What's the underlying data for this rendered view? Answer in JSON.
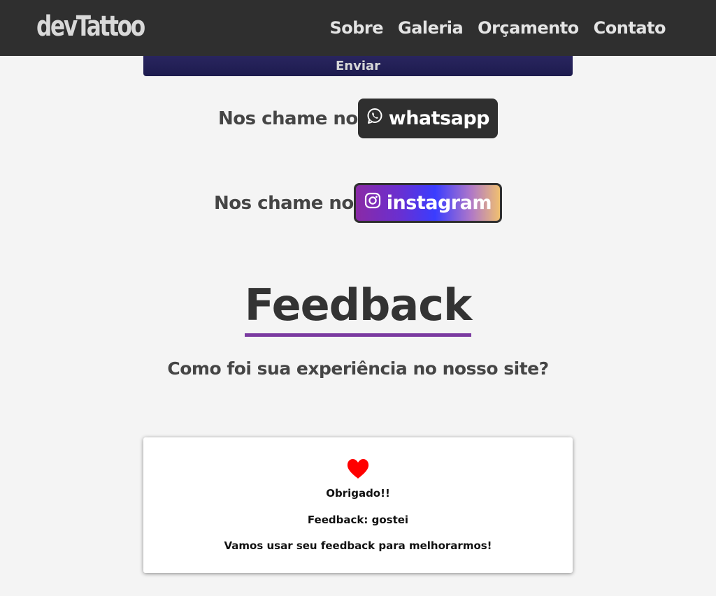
{
  "header": {
    "logo": "devTattoo",
    "nav": [
      "Sobre",
      "Galeria",
      "Orçamento",
      "Contato"
    ]
  },
  "form": {
    "submit_label": "Enviar"
  },
  "contact": {
    "whatsapp_prefix": "Nos chame no",
    "whatsapp_label": "whatsapp",
    "instagram_prefix": "Nos chame no",
    "instagram_label": "instagram"
  },
  "feedback": {
    "title": "Feedback",
    "question": "Como foi sua experiência no nosso site?",
    "card": {
      "icon": "heart-icon",
      "thanks": "Obrigado!!",
      "result": "Feedback: gostei",
      "message": "Vamos usar seu feedback para melhorarmos!"
    }
  },
  "colors": {
    "navbar": "#2f2f2f",
    "accent_underline": "#7a3aa0",
    "heart": "#ff0000"
  }
}
